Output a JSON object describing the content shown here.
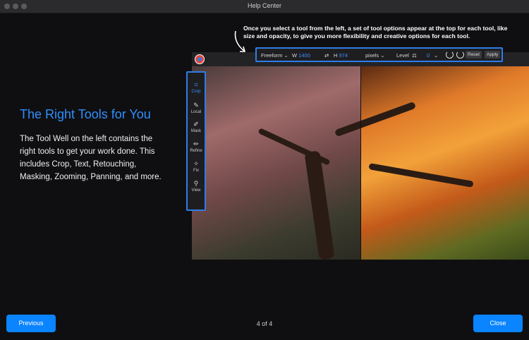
{
  "window": {
    "title": "Help Center"
  },
  "content": {
    "heading": "The Right Tools for You",
    "body": "The Tool Well on the left contains the right tools to get your work done. This includes Crop, Text, Retouching, Masking, Zooming, Panning, and more.",
    "callout": "Once you select a tool from the left, a set of tool options appear at the top for each tool, like size and opacity, to give you more flexibility and creative options for each tool."
  },
  "options_bar": {
    "preset": "Freeform",
    "w_label": "W",
    "w_value": "1400",
    "h_label": "H",
    "h_value": "974",
    "units": "pixels",
    "level_label": "Level",
    "level_value": "0",
    "reset_label": "Reset",
    "apply_label": "Apply"
  },
  "tool_well": [
    {
      "label": "Crop",
      "icon": "crop-icon",
      "active": true
    },
    {
      "label": "Local",
      "icon": "local-brush-icon",
      "active": false
    },
    {
      "label": "Mask",
      "icon": "mask-brush-icon",
      "active": false
    },
    {
      "label": "Refine",
      "icon": "refine-brush-icon",
      "active": false
    },
    {
      "label": "Fix",
      "icon": "fix-icon",
      "active": false
    },
    {
      "label": "View",
      "icon": "magnifier-icon",
      "active": false
    }
  ],
  "footer": {
    "previous_label": "Previous",
    "page_indicator": "4 of 4",
    "close_label": "Close"
  },
  "colors": {
    "accent": "#0a84ff",
    "heading": "#2f8fff",
    "background": "#0f0f11"
  }
}
